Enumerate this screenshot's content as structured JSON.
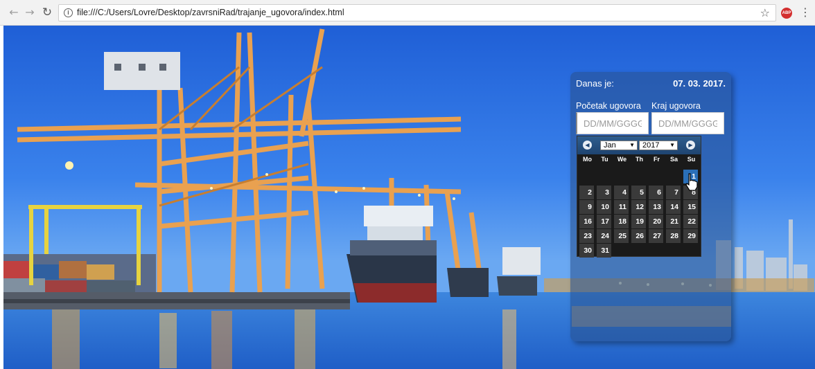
{
  "browser": {
    "url": "file:///C:/Users/Lovre/Desktop/zavrsniRad/trajanje_ugovora/index.html",
    "abp_label": "ABP"
  },
  "panel": {
    "today_label": "Danas je:",
    "today_value": "07. 03. 2017.",
    "start_label": "Početak ugovora",
    "end_label": "Kraj ugovora",
    "start_placeholder": "DD/MM/GGGG",
    "end_placeholder": "DD/MM/GGGG"
  },
  "datepicker": {
    "month": "Jan",
    "year": "2017",
    "weekdays": [
      "Mo",
      "Tu",
      "We",
      "Th",
      "Fr",
      "Sa",
      "Su"
    ],
    "days": [
      "1",
      "2",
      "3",
      "4",
      "5",
      "6",
      "7",
      "8",
      "9",
      "10",
      "11",
      "12",
      "13",
      "14",
      "15",
      "16",
      "17",
      "18",
      "19",
      "20",
      "21",
      "22",
      "23",
      "24",
      "25",
      "26",
      "27",
      "28",
      "29",
      "30",
      "31"
    ],
    "selected_day": "1",
    "first_weekday_index": 6
  },
  "colors": {
    "panel_bg": "#28508c",
    "datepicker_header": "#1e4470",
    "selected_day": "#2a6fb8"
  }
}
